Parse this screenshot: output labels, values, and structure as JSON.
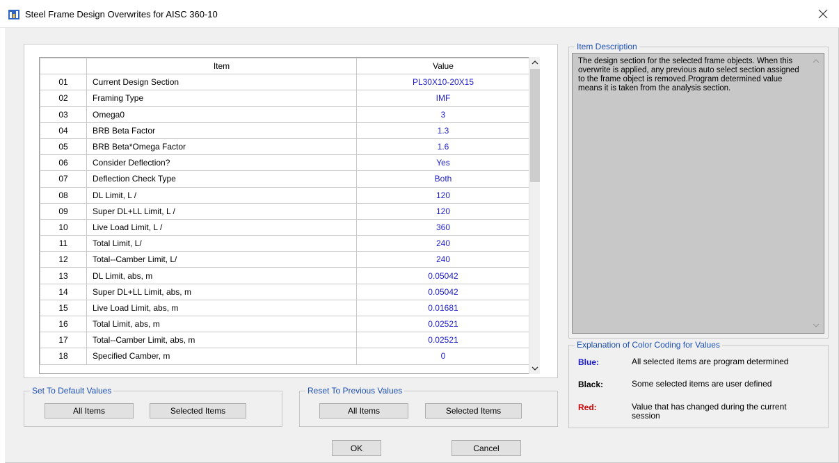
{
  "window": {
    "title": "Steel Frame Design Overwrites for AISC 360-10"
  },
  "grid": {
    "header_item": "Item",
    "header_value": "Value",
    "rows": [
      {
        "num": "01",
        "item": "Current Design Section",
        "value": "PL30X10-20X15"
      },
      {
        "num": "02",
        "item": "Framing Type",
        "value": "IMF"
      },
      {
        "num": "03",
        "item": "Omega0",
        "value": "3"
      },
      {
        "num": "04",
        "item": "BRB Beta Factor",
        "value": "1.3"
      },
      {
        "num": "05",
        "item": "BRB Beta*Omega Factor",
        "value": "1.6"
      },
      {
        "num": "06",
        "item": "Consider Deflection?",
        "value": "Yes"
      },
      {
        "num": "07",
        "item": "Deflection Check Type",
        "value": "Both"
      },
      {
        "num": "08",
        "item": "DL Limit, L /",
        "value": "120"
      },
      {
        "num": "09",
        "item": "Super DL+LL Limit, L /",
        "value": "120"
      },
      {
        "num": "10",
        "item": "Live Load Limit, L /",
        "value": "360"
      },
      {
        "num": "11",
        "item": "Total Limit, L/",
        "value": "240"
      },
      {
        "num": "12",
        "item": "Total--Camber Limit, L/",
        "value": "240"
      },
      {
        "num": "13",
        "item": "DL Limit, abs, m",
        "value": "0.05042"
      },
      {
        "num": "14",
        "item": "Super DL+LL Limit, abs, m",
        "value": "0.05042"
      },
      {
        "num": "15",
        "item": "Live Load Limit, abs, m",
        "value": "0.01681"
      },
      {
        "num": "16",
        "item": "Total Limit, abs, m",
        "value": "0.02521"
      },
      {
        "num": "17",
        "item": "Total--Camber Limit, abs, m",
        "value": "0.02521"
      },
      {
        "num": "18",
        "item": "Specified Camber, m",
        "value": "0"
      }
    ]
  },
  "defaults_group": {
    "label": "Set To Default Values",
    "all_items": "All Items",
    "selected_items": "Selected Items"
  },
  "reset_group": {
    "label": "Reset To Previous Values",
    "all_items": "All Items",
    "selected_items": "Selected Items"
  },
  "description": {
    "label": "Item Description",
    "text": "The design section for the selected frame objects.  When this overwrite is applied, any previous auto select section assigned to the frame object is removed.Program determined value means it is taken from the analysis section."
  },
  "legend": {
    "label": "Explanation of Color Coding for Values",
    "items": [
      {
        "key": "Blue:",
        "desc": "All selected items are program determined",
        "color": "#1c1cc8"
      },
      {
        "key": "Black:",
        "desc": "Some selected items are user defined",
        "color": "#000000"
      },
      {
        "key": "Red:",
        "desc": "Value that has changed during the current session",
        "color": "#d00000"
      }
    ]
  },
  "footer": {
    "ok": "OK",
    "cancel": "Cancel"
  },
  "colors": {
    "value_blue": "#1c1cc8",
    "label_blue": "#1d4fb0"
  },
  "icons": {
    "app": "etabs-app-icon",
    "close": "close-icon"
  }
}
